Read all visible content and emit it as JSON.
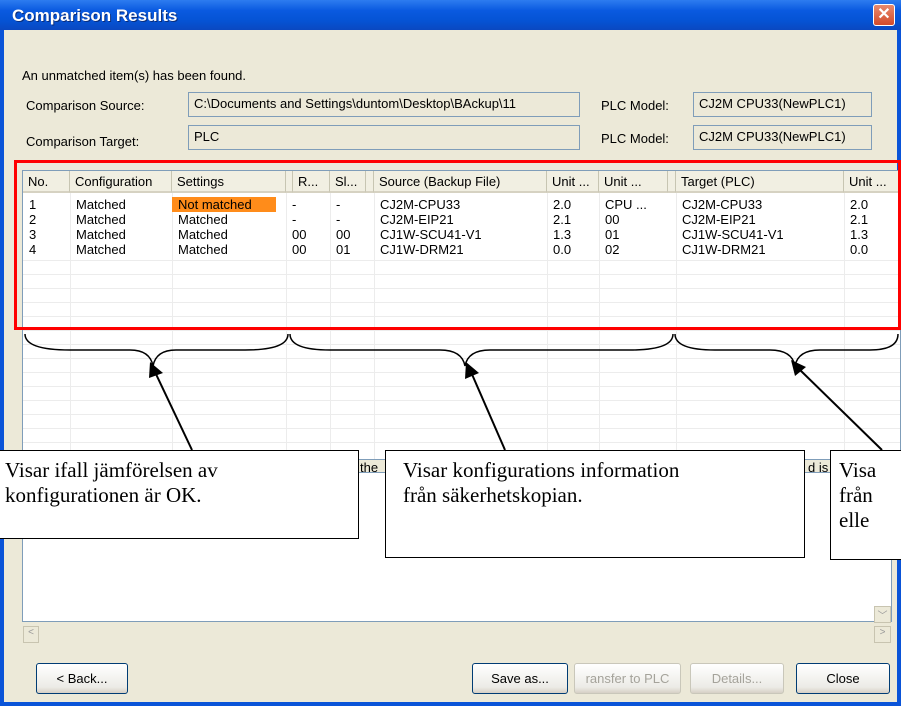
{
  "window": {
    "title": "Comparison Results",
    "close_glyph": "✕"
  },
  "message": "An unmatched item(s) has been found.",
  "source": {
    "label": "Comparison Source:",
    "value": "C:\\Documents and Settings\\duntom\\Desktop\\BAckup\\11",
    "plc_model_label": "PLC Model:",
    "plc_model_value": "CJ2M CPU33(NewPLC1)"
  },
  "target": {
    "label": "Comparison Target:",
    "value": "PLC",
    "plc_model_label": "PLC Model:",
    "plc_model_value": "CJ2M CPU33(NewPLC1)"
  },
  "table": {
    "columns": [
      "No.",
      "Configuration",
      "Settings",
      "R...",
      "Sl...",
      "Source (Backup File)",
      "Unit ...",
      "Unit ...",
      "Target (PLC)",
      "Unit ..."
    ],
    "rows": [
      [
        "1",
        "Matched",
        "Not matched",
        "-",
        "-",
        "CJ2M-CPU33",
        "2.0",
        "CPU ...",
        "CJ2M-CPU33",
        "2.0"
      ],
      [
        "2",
        "Matched",
        "Matched",
        "-",
        "-",
        "CJ2M-EIP21",
        "2.1",
        "00",
        "CJ2M-EIP21",
        "2.1"
      ],
      [
        "3",
        "Matched",
        "Matched",
        "00",
        "00",
        "CJ1W-SCU41-V1",
        "1.3",
        "01",
        "CJ1W-SCU41-V1",
        "1.3"
      ],
      [
        "4",
        "Matched",
        "Matched",
        "00",
        "01",
        "CJ1W-DRM21",
        "0.0",
        "02",
        "CJ1W-DRM21",
        "0.0"
      ]
    ],
    "highlight_color": "#ff8c1a"
  },
  "fragments": {
    "the": "the",
    "d_is_sh": "d is sh"
  },
  "callouts": {
    "left": [
      "Visar ifall jämförelsen av",
      "konfigurationen är OK."
    ],
    "middle": [
      "Visar konfigurations information",
      "från säkerhetskopian."
    ],
    "right": [
      "Visa",
      "från",
      "elle"
    ]
  },
  "buttons": {
    "back": "< Back...",
    "save_as": "Save as...",
    "transfer": "ransfer to PLC",
    "details": "Details...",
    "close": "Close"
  },
  "icons": {
    "scroll_left": "<",
    "scroll_right": ">",
    "scroll_down": "﹀"
  },
  "colors": {
    "title_bar": "#0a5ae0",
    "annotation_border": "#ff0000"
  }
}
